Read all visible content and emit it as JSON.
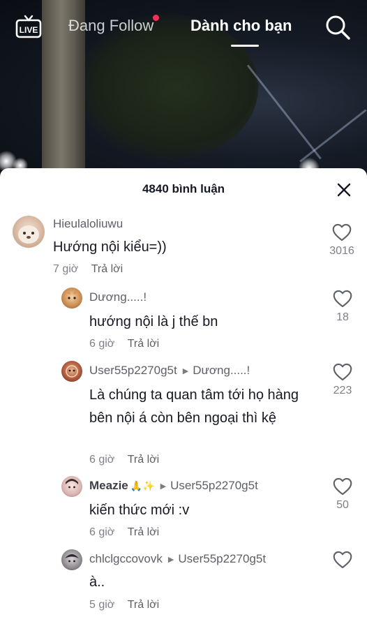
{
  "topbar": {
    "live_label": "LIVE",
    "tab_following": "Đang Follow",
    "tab_for_you": "Dành cho bạn"
  },
  "sheet": {
    "title": "4840 bình luận",
    "reply_label": "Trả lời"
  },
  "comments": [
    {
      "username": "Hieulaloliuwu",
      "text": "Hướng nội kiểu=))",
      "time": "7 giờ",
      "likes": "3016"
    },
    {
      "username": "Dương.....!",
      "text": "hướng nội là j thế bn",
      "time": "6 giờ",
      "likes": "18"
    },
    {
      "username": "User55p2270g5t",
      "reply_to": "Dương.....!",
      "text": "Là chúng ta quan tâm tới họ hàng bên nội á còn bên ngoại thì kệ",
      "time": "6 giờ",
      "likes": "223"
    },
    {
      "username": "Meazie",
      "username_emoji": "🙏✨",
      "reply_to": "User55p2270g5t",
      "text": "kiến thức mới :v",
      "time": "6 giờ",
      "likes": "50"
    },
    {
      "username": "chlclgccovovk",
      "reply_to": "User55p2270g5t",
      "text": "à..",
      "time": "5 giờ",
      "likes": ""
    }
  ],
  "colors": {
    "accent": "#fe2c55",
    "text_primary": "#161823",
    "text_secondary": "#7e8088"
  },
  "icons": [
    "live-icon",
    "search-icon",
    "close-icon",
    "heart-icon",
    "reply-arrow-icon"
  ]
}
